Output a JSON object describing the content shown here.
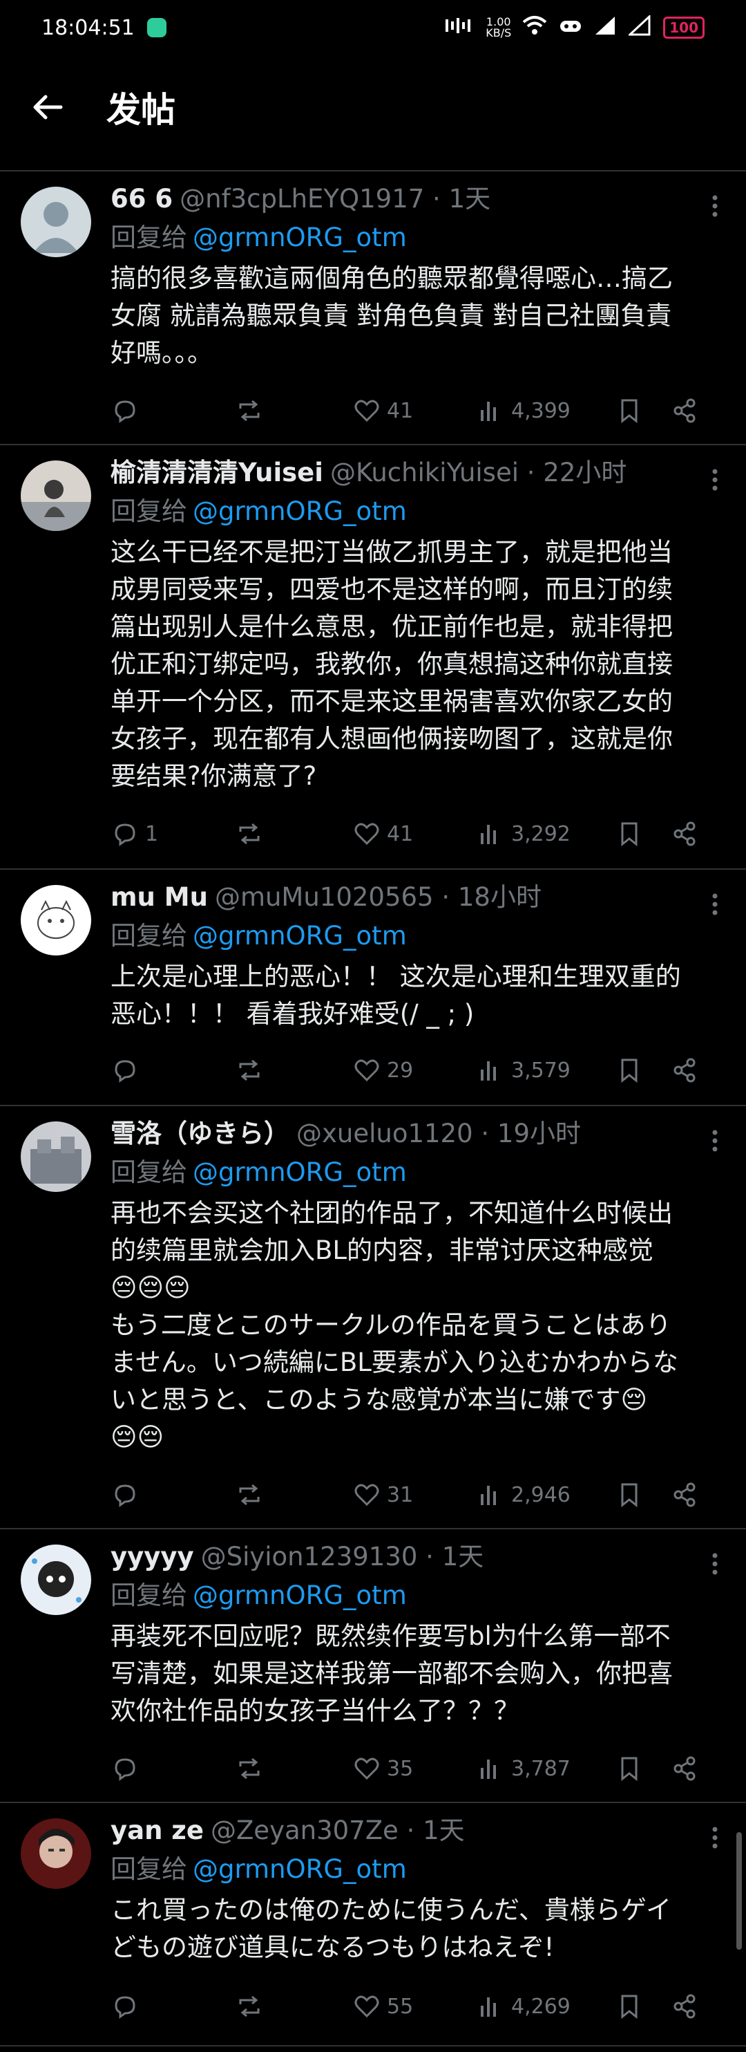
{
  "status": {
    "time": "18:04:51",
    "net_speed": "1.00\nKB/S",
    "battery": "100"
  },
  "nav": {
    "title": "发帖"
  },
  "replying_prefix": "回复给",
  "replies": [
    {
      "name": "66 6",
      "handle": "@nf3cpLhEYQ1917 · 1天",
      "mention": "@grmnORG_otm",
      "text": "搞的很多喜歡這兩個角色的聽眾都覺得噁心…搞乙\n女腐 就請為聽眾負責 對角色負責 對自己社團負責\n好嗎。。。",
      "reply_count": "",
      "likes": "41",
      "views": "4,399"
    },
    {
      "name": "榆清清清清Yuisei",
      "handle": "@KuchikiYuisei · 22小时",
      "mention": "@grmnORG_otm",
      "text": "这么干已经不是把汀当做乙抓男主了，就是把他当\n成男同受来写，四爱也不是这样的啊，而且汀的续\n篇出现别人是什么意思，优正前作也是，就非得把\n优正和汀绑定吗，我教你，你真想搞这种你就直接\n单开一个分区，而不是来这里祸害喜欢你家乙女的\n女孩子，现在都有人想画他俩接吻图了，这就是你\n要结果?你满意了?",
      "reply_count": "1",
      "likes": "41",
      "views": "3,292"
    },
    {
      "name": "mu Mu",
      "handle": "@muMu1020565 · 18小时",
      "mention": "@grmnORG_otm",
      "text": "上次是心理上的恶心！！ 这次是心理和生理双重的\n恶心！！！ 看着我好难受(/ _ ; )",
      "reply_count": "",
      "likes": "29",
      "views": "3,579"
    },
    {
      "name": "雪洛（ゆきら）",
      "handle": "@xueluo1120 · 19小时",
      "mention": "@grmnORG_otm",
      "text": "再也不会买这个社团的作品了，不知道什么时候出\n的续篇里就会加入BL的内容，非常讨厌这种感觉\n😔😔😔\nもう二度とこのサークルの作品を買うことはあり\nません。いつ続編にBL要素が入り込むかわからな\nいと思うと、このような感覚が本当に嫌です😔\n😔😔",
      "reply_count": "",
      "likes": "31",
      "views": "2,946"
    },
    {
      "name": "yyyyy",
      "handle": "@Siyion1239130 · 1天",
      "mention": "@grmnORG_otm",
      "text": "再装死不回应呢？既然续作要写bl为什么第一部不\n写清楚，如果是这样我第一部都不会购入，你把喜\n欢你社作品的女孩子当什么了？？？",
      "reply_count": "",
      "likes": "35",
      "views": "3,787"
    },
    {
      "name": "yan ze",
      "handle": "@Zeyan307Ze · 1天",
      "mention": "@grmnORG_otm",
      "text": "これ買ったのは俺のために使うんだ、貴様らゲイ\nどもの遊び道具になるつもりはねえぞ!",
      "reply_count": "",
      "likes": "55",
      "views": "4,269"
    }
  ]
}
